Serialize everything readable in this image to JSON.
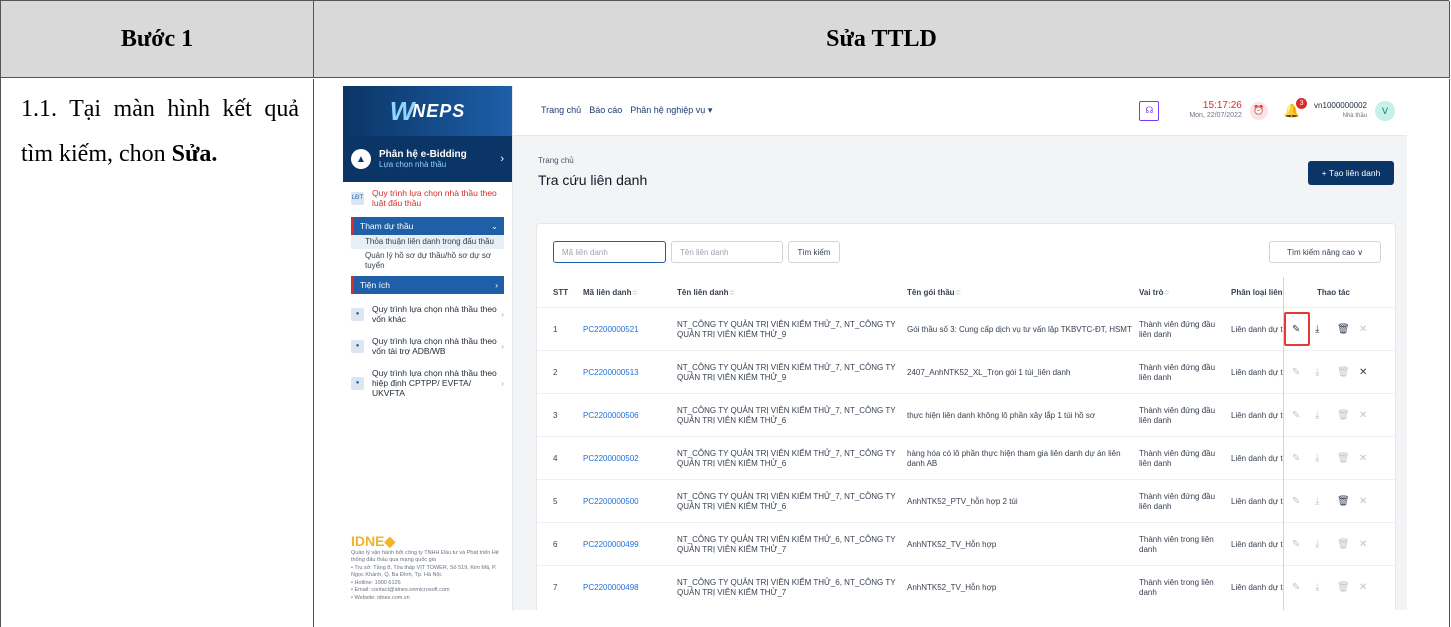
{
  "doc": {
    "header_step": "Bước 1",
    "header_title": "Sửa TTLD",
    "instruction_prefix": "1.1. Tại màn hình kết quả tìm kiếm, chon ",
    "instruction_bold": "Sửa."
  },
  "app": {
    "logo": "NEPS",
    "module_title": "Phân hệ e-Bidding",
    "module_sub": "Lựa chọn nhà thầu",
    "sidebar": {
      "proc1": "Quy trình lựa chọn nhà thầu theo luật đấu thầu",
      "group1": "Tham dự thầu",
      "sub1": "Thỏa thuận liên danh trong đấu thầu",
      "sub2": "Quản lý hồ sơ dự thầu/hồ sơ dự sơ tuyển",
      "group2": "Tiện ích",
      "proc2": "Quy trình lựa chọn nhà thầu theo vốn khác",
      "proc3": "Quy trình lựa chọn nhà thầu theo vốn tài trợ ADB/WB",
      "proc4": "Quy trình lựa chọn nhà thầu theo hiệp định CPTPP/ EVFTA/ UKVFTA"
    },
    "footer": {
      "brand": "IDNE",
      "l1": "Quản lý vận hành bởi công ty TNHH Đầu tư và Phát triển Hệ thống đấu thầu qua mạng quốc gia",
      "l2": "• Trụ sở: Tầng 8, Tòa tháp VIT TOWER, Số 519, Kim Mã, P. Ngọc Khánh, Q. Ba Đình, Tp. Hà Nội.",
      "l3": "• Hotline: 1900 6126",
      "l4": "• Email: contact@idnes.onmicrosoft.com",
      "l5": "• Website: idnes.com.vn"
    },
    "topnav": {
      "home": "Trang chủ",
      "report": "Báo cáo",
      "modules": "Phân hệ nghiệp vụ"
    },
    "clock": {
      "time": "15:17:26",
      "date": "Mon, 22/07/2022"
    },
    "notifications": "3",
    "user": {
      "id": "vn1000000002",
      "role": "Nhà thầu",
      "avatar": "V"
    },
    "breadcrumb": "Trang chủ",
    "page_title": "Tra cứu liên danh",
    "create_button": "+ Tạo liên danh",
    "search": {
      "code_placeholder": "Mã liên danh",
      "name_placeholder": "Tên liên danh",
      "search_button": "Tìm kiếm",
      "advanced": "Tìm kiếm nâng cao ∨"
    },
    "columns": {
      "stt": "STT",
      "code": "Mã liên danh",
      "name": "Tên liên danh",
      "package": "Tên gói thầu",
      "role": "Vai trò",
      "type": "Phân loại liên",
      "actions": "Thao tác"
    },
    "rows": [
      {
        "stt": "1",
        "code": "PC2200000521",
        "name": "NT_CÔNG TY QUẢN TRỊ VIÊN KIỂM THỬ_7, NT_CÔNG TY QUẢN TRỊ VIÊN KIỂM THỬ_9",
        "package": "Gói thầu số 3: Cung cấp dịch vụ tư vấn lập TKBVTC-ĐT, HSMT",
        "role": "Thành viên đứng đầu liên danh",
        "type": "Liên danh dự t"
      },
      {
        "stt": "2",
        "code": "PC2200000513",
        "name": "NT_CÔNG TY QUẢN TRỊ VIÊN KIỂM THỬ_7, NT_CÔNG TY QUẢN TRỊ VIÊN KIỂM THỬ_9",
        "package": "2407_AnhNTK52_XL_Trọn gói 1 túi_liên danh",
        "role": "Thành viên đứng đầu liên danh",
        "type": "Liên danh dự t"
      },
      {
        "stt": "3",
        "code": "PC2200000506",
        "name": "NT_CÔNG TY QUẢN TRỊ VIÊN KIỂM THỬ_7, NT_CÔNG TY QUẢN TRỊ VIÊN KIỂM THỬ_6",
        "package": "thực hiện liên danh không lô phần xây lắp 1 túi hồ sơ",
        "role": "Thành viên đứng đầu liên danh",
        "type": "Liên danh dự t"
      },
      {
        "stt": "4",
        "code": "PC2200000502",
        "name": "NT_CÔNG TY QUẢN TRỊ VIÊN KIỂM THỬ_7, NT_CÔNG TY QUẢN TRỊ VIÊN KIỂM THỬ_6",
        "package": "hàng hóa có lô phần thực hiện tham gia liên danh dự án liên danh AB",
        "role": "Thành viên đứng đầu liên danh",
        "type": "Liên danh dự t"
      },
      {
        "stt": "5",
        "code": "PC2200000500",
        "name": "NT_CÔNG TY QUẢN TRỊ VIÊN KIỂM THỬ_7, NT_CÔNG TY QUẢN TRỊ VIÊN KIỂM THỬ_6",
        "package": "AnhNTK52_PTV_hỗn hợp 2 túi",
        "role": "Thành viên đứng đầu liên danh",
        "type": "Liên danh dự t"
      },
      {
        "stt": "6",
        "code": "PC2200000499",
        "name": "NT_CÔNG TY QUẢN TRỊ VIÊN KIỂM THỬ_6, NT_CÔNG TY QUẢN TRỊ VIÊN KIỂM THỬ_7",
        "package": "AnhNTK52_TV_Hỗn hợp",
        "role": "Thành viên trong liên danh",
        "type": "Liên danh dự t"
      },
      {
        "stt": "7",
        "code": "PC2200000498",
        "name": "NT_CÔNG TY QUẢN TRỊ VIÊN KIỂM THỬ_6, NT_CÔNG TY QUẢN TRỊ VIÊN KIỂM THỬ_7",
        "package": "AnhNTK52_TV_Hỗn hợp",
        "role": "Thành viên trong liên danh",
        "type": "Liên danh dự t"
      }
    ],
    "icons": {
      "edit": "✎",
      "download": "⤓",
      "delete": "🗑",
      "close": "✕"
    }
  }
}
